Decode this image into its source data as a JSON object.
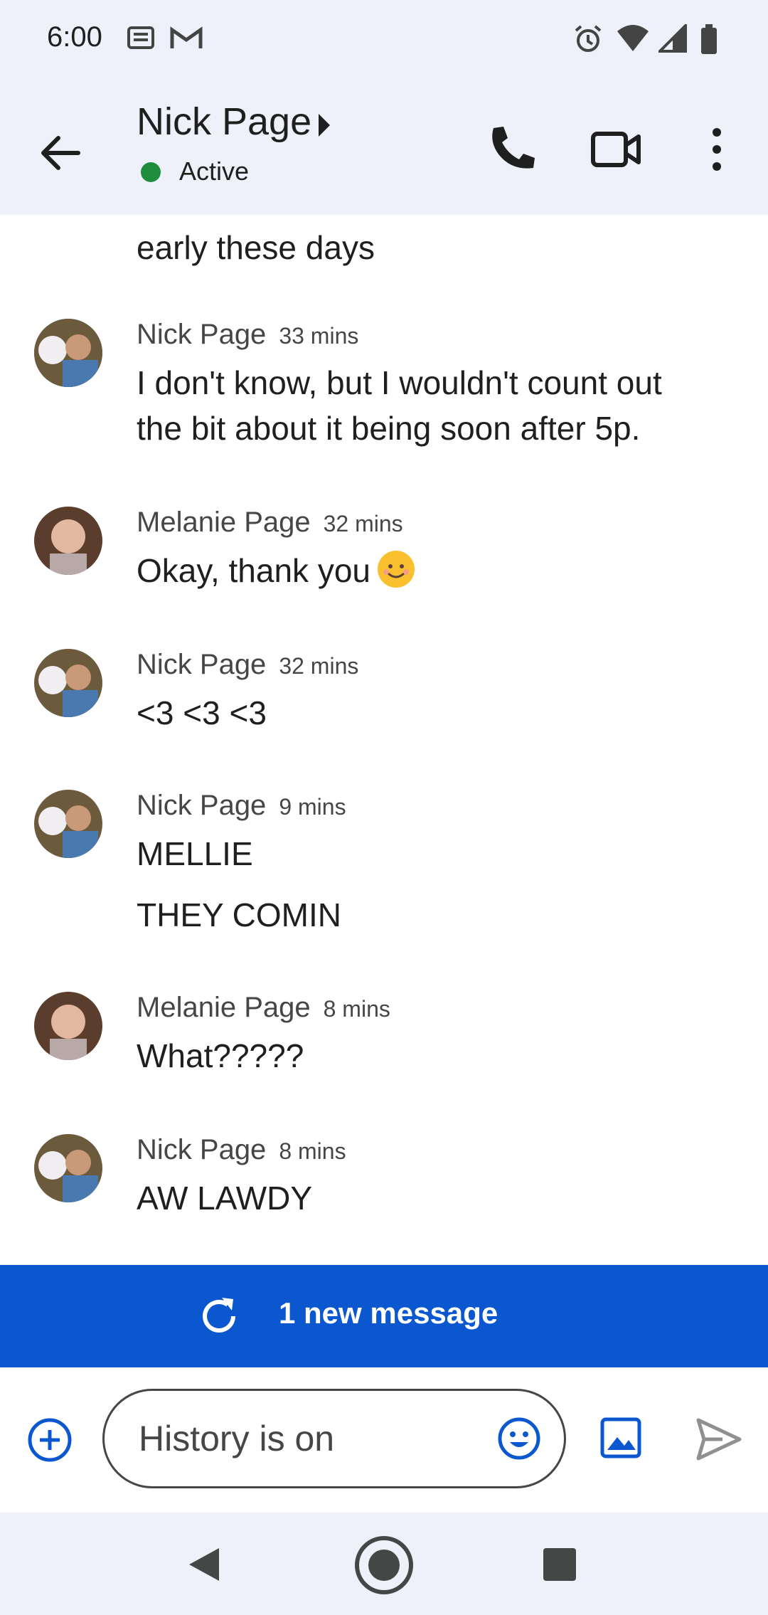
{
  "status_bar": {
    "time": "6:00",
    "left_icons": [
      "news-icon",
      "gmail-icon"
    ],
    "right_icons": [
      "alarm-icon",
      "wifi-icon",
      "cell-signal-icon",
      "battery-icon"
    ]
  },
  "app_bar": {
    "contact_name": "Nick Page",
    "status": "Active",
    "status_color": "#1e8e3e",
    "actions": [
      "phone-icon",
      "video-icon",
      "more-options-icon"
    ]
  },
  "chat": {
    "partial_line": "early these days",
    "messages": [
      {
        "sender": "Nick Page",
        "time": "33 mins",
        "lines": [
          "I don't know, but I wouldn't count out",
          "the bit about it being soon after 5p."
        ]
      },
      {
        "sender": "Melanie Page",
        "time": "32 mins",
        "lines": [
          "Okay, thank you"
        ],
        "emoji": "smiling-face-icon"
      },
      {
        "sender": "Nick Page",
        "time": "32 mins",
        "lines": [
          "<3 <3 <3"
        ]
      },
      {
        "sender": "Nick Page",
        "time": "9 mins",
        "lines": [
          "MELLIE",
          "THEY COMIN"
        ]
      },
      {
        "sender": "Melanie Page",
        "time": "8 mins",
        "lines": [
          "What?????"
        ]
      },
      {
        "sender": "Nick Page",
        "time": "8 mins",
        "lines": [
          "AW LAWDY"
        ]
      }
    ]
  },
  "banner": {
    "label": "1 new message",
    "color": "#0b57d0"
  },
  "compose": {
    "placeholder": "History is on"
  },
  "colors": {
    "accent": "#0b57d0",
    "bar_bg": "#eef1fa"
  }
}
